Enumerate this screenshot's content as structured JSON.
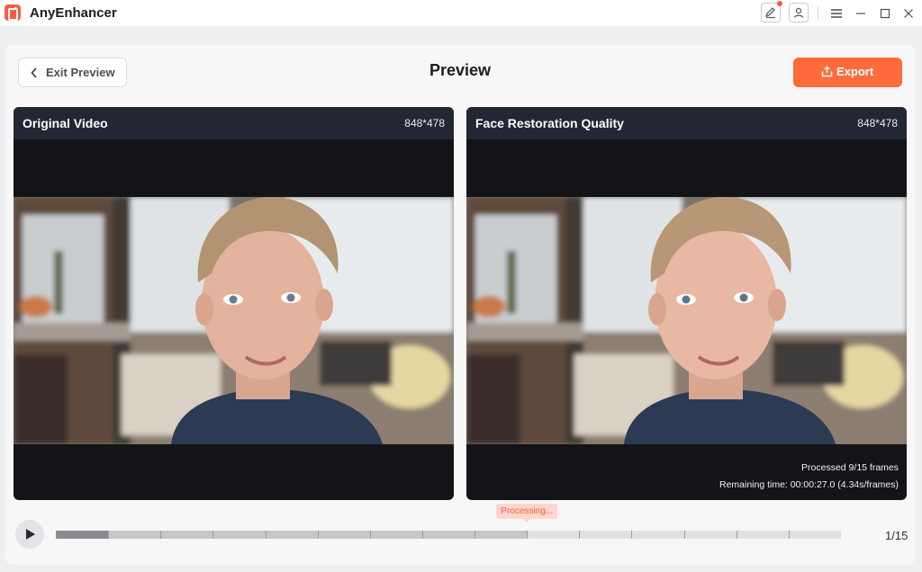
{
  "app": {
    "name": "AnyEnhancer"
  },
  "icons": {
    "logo": "anyenhancer-logo-icon",
    "feedback": "edit-feedback-icon",
    "account": "user-account-icon",
    "menu": "hamburger-menu-icon",
    "minimize": "minimize-icon",
    "maximize": "maximize-icon",
    "close": "close-icon",
    "back": "chevron-left-icon",
    "export": "upload-icon",
    "play": "play-icon"
  },
  "header": {
    "exit_label": "Exit Preview",
    "title": "Preview",
    "export_label": "Export"
  },
  "panes": {
    "original": {
      "title": "Original Video",
      "resolution": "848*478"
    },
    "enhanced": {
      "title": "Face Restoration Quality",
      "resolution": "848*478",
      "processed": "Processed 9/15 frames",
      "remaining": "Remaining time: 00:00:27.0 (4.34s/frames)"
    }
  },
  "timeline": {
    "processing_label": "Processing...",
    "counter": "1/15",
    "total_frames": 15,
    "current_frame": 1,
    "processed_frames": 9
  },
  "colors": {
    "accent": "#ff6b3d",
    "pane_header": "#222733",
    "badge_bg": "#ffd6cc"
  }
}
